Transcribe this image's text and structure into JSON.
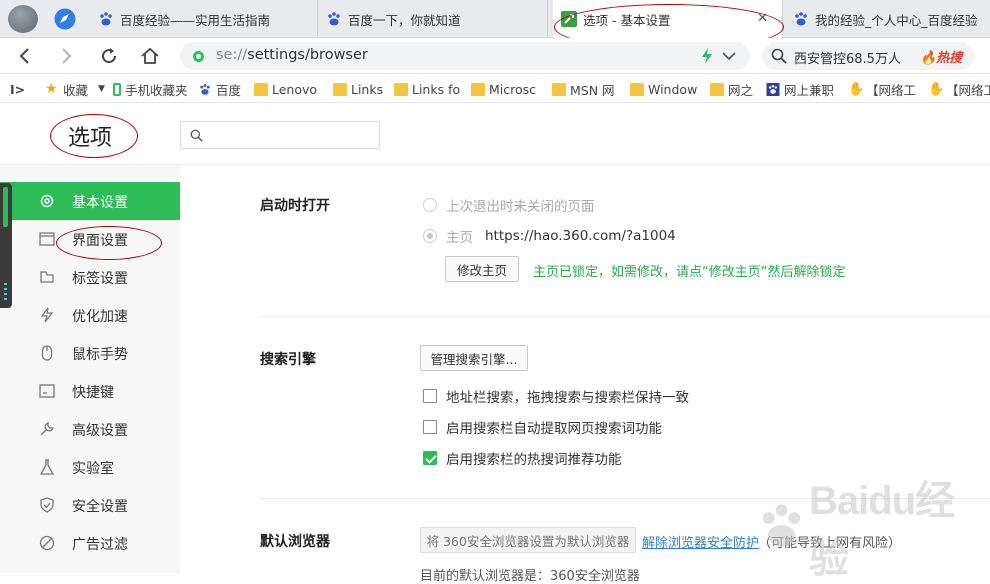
{
  "tabs": [
    {
      "title": "百度经验——实用生活指南",
      "icon": "baidu-paw-icon"
    },
    {
      "title": "百度一下，你就知道",
      "icon": "baidu-paw-icon"
    },
    {
      "title": "选项 - 基本设置",
      "icon": "settings-wrench-icon",
      "active": true
    },
    {
      "title": "我的经验_个人中心_百度经验",
      "icon": "baidu-paw-icon"
    }
  ],
  "address": {
    "scheme": "se://",
    "path": "settings/browser"
  },
  "search": {
    "query": "西安管控68.5万人",
    "hot_label": "🔥热搜"
  },
  "bookmarks": [
    {
      "label": "收藏",
      "icon": "star-icon"
    },
    {
      "label": "手机收藏夹",
      "icon": "phone-icon"
    },
    {
      "label": "百度",
      "icon": "baidu-paw-icon"
    },
    {
      "label": "Lenovo",
      "icon": "folder-icon"
    },
    {
      "label": "Links",
      "icon": "folder-icon"
    },
    {
      "label": "Links fo",
      "icon": "folder-icon"
    },
    {
      "label": "Microsc",
      "icon": "folder-icon"
    },
    {
      "label": "MSN 网",
      "icon": "folder-icon"
    },
    {
      "label": "Window",
      "icon": "folder-icon"
    },
    {
      "label": "网之",
      "icon": "folder-icon"
    },
    {
      "label": "网上兼职",
      "icon": "baidu-paw-icon"
    },
    {
      "label": "【网络工",
      "icon": "hand-icon"
    },
    {
      "label": "【网络工",
      "icon": "hand-icon"
    }
  ],
  "page": {
    "title": "选项",
    "search_placeholder": ""
  },
  "sidebar": {
    "items": [
      {
        "label": "基本设置",
        "icon": "gear-icon",
        "active": true
      },
      {
        "label": "界面设置",
        "icon": "window-icon"
      },
      {
        "label": "标签设置",
        "icon": "tab-icon"
      },
      {
        "label": "优化加速",
        "icon": "lightning-icon"
      },
      {
        "label": "鼠标手势",
        "icon": "mouse-icon"
      },
      {
        "label": "快捷键",
        "icon": "keyboard-icon"
      },
      {
        "label": "高级设置",
        "icon": "wrench-icon"
      },
      {
        "label": "实验室",
        "icon": "flask-icon"
      },
      {
        "label": "安全设置",
        "icon": "shield-icon"
      },
      {
        "label": "广告过滤",
        "icon": "block-icon"
      }
    ]
  },
  "startup": {
    "title": "启动时打开",
    "option_last": "上次退出时未关闭的页面",
    "option_home_label": "主页",
    "option_home_url": "https://hao.360.com/?a1004",
    "modify_button": "修改主页",
    "locked_note": "主页已锁定，如需修改，请点“修改主页”然后解除锁定"
  },
  "search_engine": {
    "title": "搜索引擎",
    "manage_button": "管理搜索引擎...",
    "options": [
      {
        "label": "地址栏搜索，拖拽搜索与搜索栏保持一致",
        "checked": false
      },
      {
        "label": "启用搜索栏自动提取网页搜索词功能",
        "checked": false
      },
      {
        "label": "启用搜索栏的热搜词推荐功能",
        "checked": true
      }
    ]
  },
  "default_browser": {
    "title": "默认浏览器",
    "set_button": "将 360安全浏览器设置为默认浏览器",
    "unlock_link": "解除浏览器安全防护",
    "warning": "（可能导致上网有风险）",
    "status": "目前的默认浏览器是：360安全浏览器"
  },
  "watermark": {
    "text": "Baidu经验"
  },
  "colors": {
    "accent_green": "#2dbc56",
    "hot_red": "#e8412c",
    "link_blue": "#2f7fd3"
  }
}
